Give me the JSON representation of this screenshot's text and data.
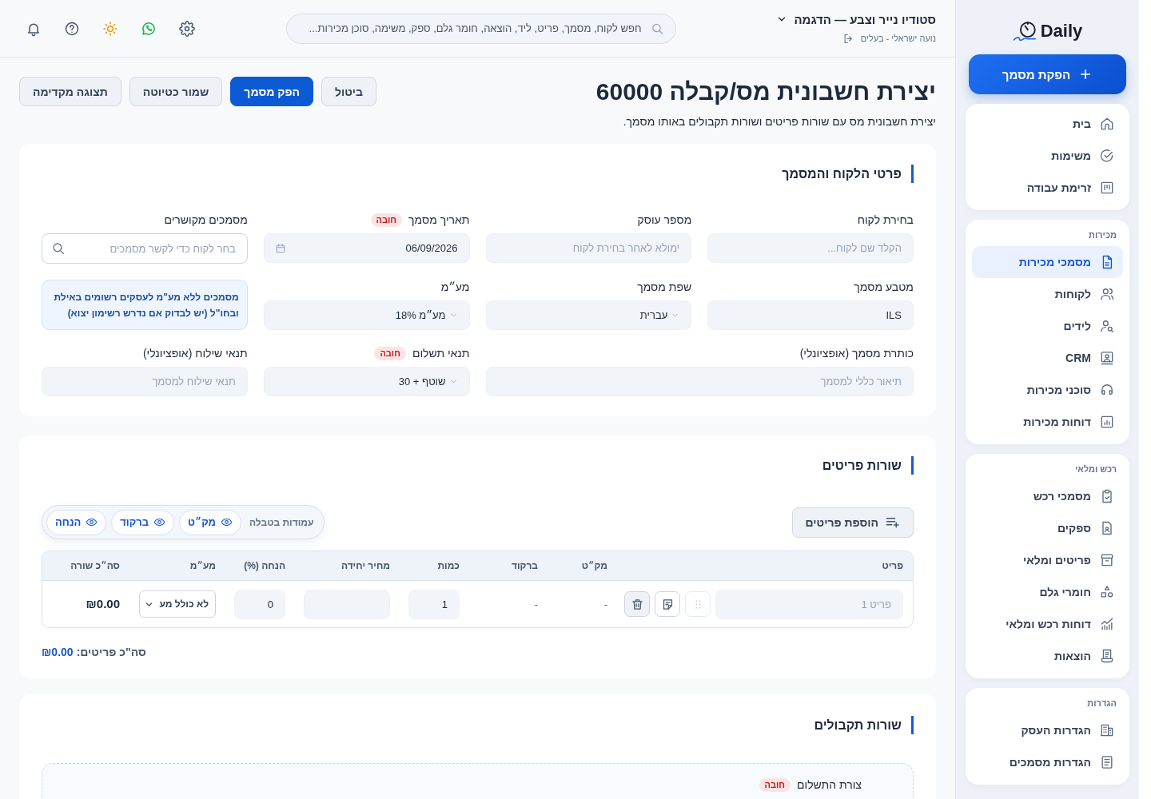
{
  "sidebar": {
    "logo": "Daily",
    "create_button": "הפקת מסמך",
    "groups": [
      {
        "items": [
          {
            "label": "בית",
            "selected": false
          },
          {
            "label": "משימות",
            "selected": false
          },
          {
            "label": "זרימת עבודה",
            "selected": false
          }
        ]
      },
      {
        "title": "מכירות",
        "items": [
          {
            "label": "מסמכי מכירות",
            "selected": true
          },
          {
            "label": "לקוחות",
            "selected": false
          },
          {
            "label": "לידים",
            "selected": false
          },
          {
            "label": "CRM",
            "selected": false
          },
          {
            "label": "סוכני מכירות",
            "selected": false
          },
          {
            "label": "דוחות מכירות",
            "selected": false
          }
        ]
      },
      {
        "title": "רכש ומלאי",
        "items": [
          {
            "label": "מסמכי רכש",
            "selected": false
          },
          {
            "label": "ספקים",
            "selected": false
          },
          {
            "label": "פריטים ומלאי",
            "selected": false
          },
          {
            "label": "חומרי גלם",
            "selected": false
          },
          {
            "label": "דוחות רכש ומלאי",
            "selected": false
          },
          {
            "label": "הוצאות",
            "selected": false
          }
        ]
      },
      {
        "title": "הגדרות",
        "items": [
          {
            "label": "הגדרות העסק",
            "selected": false
          },
          {
            "label": "הגדרות מסמכים",
            "selected": false
          }
        ]
      }
    ]
  },
  "topbar": {
    "company": "סטודיו נייר וצבע — הדגמה",
    "user": "נועה ישראלי - בעלים",
    "search": {
      "placeholder": "חפש לקוח, מסמך, פריט, ליד, הוצאה, חומר גלם, ספק, משימה, סוכן מכירות..."
    }
  },
  "page_header": {
    "title": "יצירת חשבונית מס/קבלה 60000",
    "subtitle": "יצירת חשבונית מס עם שורות פריטים ושורות תקבולים באותו מסמך.",
    "actions": [
      {
        "label": "ביטול",
        "kind": "secondary"
      },
      {
        "label": "הפק מסמך",
        "kind": "primary"
      },
      {
        "label": "שמור כטיוטה",
        "kind": "secondary"
      },
      {
        "label": "תצוגה מקדימה",
        "kind": "secondary"
      }
    ]
  },
  "customer_section": {
    "title": "פרטי הלקוח והמסמך",
    "fields": [
      {
        "kind": "text",
        "label": "בחירת לקוח",
        "placeholder": "הקלד שם לקוח..."
      },
      {
        "kind": "text",
        "label": "מספר עוסק",
        "placeholder": "ימולא לאחר בחירת לקוח"
      },
      {
        "kind": "date",
        "label": "תאריך מסמך",
        "badge": "חובה",
        "value": "06/09/2026"
      },
      {
        "kind": "search",
        "label": "מסמכים מקושרים",
        "placeholder": "בחר לקוח כדי לקשר מסמכים"
      },
      {
        "kind": "text",
        "label": "מטבע מסמך",
        "value": "ILS"
      },
      {
        "kind": "select",
        "label": "שפת מסמך",
        "value": "עברית"
      },
      {
        "kind": "select",
        "label": "מע״מ",
        "value": "מע״מ 18%"
      },
      {
        "kind": "note",
        "text": "מסמכים ללא מע\"מ לעסקים רשומים באילת ובחו\"ל (יש לבדוק אם נדרש רשימון יצוא)"
      },
      {
        "kind": "text",
        "label": "כותרת מסמך (אופציונלי)",
        "placeholder": "תיאור כללי למסמך"
      },
      {
        "kind": "select",
        "label": "תנאי תשלום",
        "badge": "חובה",
        "value": "שוטף + 30"
      },
      {
        "kind": "text",
        "label": "תנאי שילוח (אופציונלי)",
        "placeholder": "תנאי שילוח למסמך"
      }
    ]
  },
  "items_section": {
    "title": "שורות פריטים",
    "add_button": "הוספת פריטים",
    "column_toggles": {
      "label": "עמודות בטבלה",
      "items": [
        {
          "label": "מק״ט",
          "on": true
        },
        {
          "label": "ברקוד",
          "on": true
        },
        {
          "label": "הנחה",
          "on": true
        }
      ]
    },
    "table": {
      "columns": [
        "פריט",
        "מק״ט",
        "ברקוד",
        "כמות",
        "מחיר יחידה",
        "הנחה (%)",
        "מע״מ",
        "סה״כ שורה"
      ],
      "rows": [
        {
          "item": {
            "placeholder": "פריט 1"
          },
          "sku": "-",
          "barcode": "-",
          "quantity": "1",
          "discount": "0",
          "vat": "לא כולל מע",
          "total": "₪0.00"
        }
      ]
    },
    "total": {
      "label": "סה\"כ פריטים:",
      "value": "₪0.00"
    }
  },
  "payments_section": {
    "title": "שורות תקבולים",
    "fields": [
      {
        "label": "צורת התשלום",
        "badge": "חובה"
      }
    ]
  }
}
